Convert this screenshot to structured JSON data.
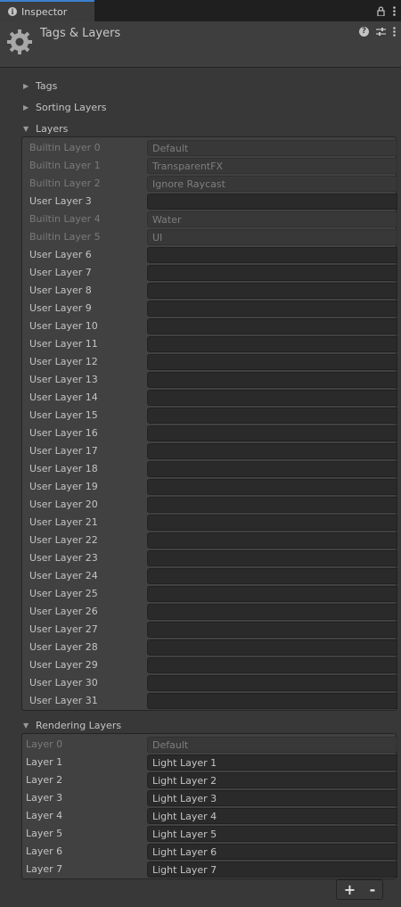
{
  "tab": {
    "label": "Inspector"
  },
  "header": {
    "title": "Tags & Layers"
  },
  "sections": {
    "tags": "Tags",
    "sorting_layers": "Sorting Layers",
    "layers": "Layers",
    "rendering_layers": "Rendering Layers"
  },
  "layers": [
    {
      "label": "Builtin Layer 0",
      "value": "Default",
      "builtin": true
    },
    {
      "label": "Builtin Layer 1",
      "value": "TransparentFX",
      "builtin": true
    },
    {
      "label": "Builtin Layer 2",
      "value": "Ignore Raycast",
      "builtin": true
    },
    {
      "label": "User Layer 3",
      "value": "",
      "builtin": false
    },
    {
      "label": "Builtin Layer 4",
      "value": "Water",
      "builtin": true
    },
    {
      "label": "Builtin Layer 5",
      "value": "UI",
      "builtin": true
    },
    {
      "label": "User Layer 6",
      "value": "",
      "builtin": false
    },
    {
      "label": "User Layer 7",
      "value": "",
      "builtin": false
    },
    {
      "label": "User Layer 8",
      "value": "",
      "builtin": false
    },
    {
      "label": "User Layer 9",
      "value": "",
      "builtin": false
    },
    {
      "label": "User Layer 10",
      "value": "",
      "builtin": false
    },
    {
      "label": "User Layer 11",
      "value": "",
      "builtin": false
    },
    {
      "label": "User Layer 12",
      "value": "",
      "builtin": false
    },
    {
      "label": "User Layer 13",
      "value": "",
      "builtin": false
    },
    {
      "label": "User Layer 14",
      "value": "",
      "builtin": false
    },
    {
      "label": "User Layer 15",
      "value": "",
      "builtin": false
    },
    {
      "label": "User Layer 16",
      "value": "",
      "builtin": false
    },
    {
      "label": "User Layer 17",
      "value": "",
      "builtin": false
    },
    {
      "label": "User Layer 18",
      "value": "",
      "builtin": false
    },
    {
      "label": "User Layer 19",
      "value": "",
      "builtin": false
    },
    {
      "label": "User Layer 20",
      "value": "",
      "builtin": false
    },
    {
      "label": "User Layer 21",
      "value": "",
      "builtin": false
    },
    {
      "label": "User Layer 22",
      "value": "",
      "builtin": false
    },
    {
      "label": "User Layer 23",
      "value": "",
      "builtin": false
    },
    {
      "label": "User Layer 24",
      "value": "",
      "builtin": false
    },
    {
      "label": "User Layer 25",
      "value": "",
      "builtin": false
    },
    {
      "label": "User Layer 26",
      "value": "",
      "builtin": false
    },
    {
      "label": "User Layer 27",
      "value": "",
      "builtin": false
    },
    {
      "label": "User Layer 28",
      "value": "",
      "builtin": false
    },
    {
      "label": "User Layer 29",
      "value": "",
      "builtin": false
    },
    {
      "label": "User Layer 30",
      "value": "",
      "builtin": false
    },
    {
      "label": "User Layer 31",
      "value": "",
      "builtin": false
    }
  ],
  "rendering_layers": [
    {
      "label": "Layer 0",
      "value": "Default",
      "builtin": true
    },
    {
      "label": "Layer 1",
      "value": "Light Layer 1",
      "builtin": false
    },
    {
      "label": "Layer 2",
      "value": "Light Layer 2",
      "builtin": false
    },
    {
      "label": "Layer 3",
      "value": "Light Layer 3",
      "builtin": false
    },
    {
      "label": "Layer 4",
      "value": "Light Layer 4",
      "builtin": false
    },
    {
      "label": "Layer 5",
      "value": "Light Layer 5",
      "builtin": false
    },
    {
      "label": "Layer 6",
      "value": "Light Layer 6",
      "builtin": false
    },
    {
      "label": "Layer 7",
      "value": "Light Layer 7",
      "builtin": false
    }
  ],
  "footer": {
    "add": "+",
    "remove": "-"
  },
  "colors": {
    "accent": "#3b7fd0",
    "background": "#383838"
  }
}
